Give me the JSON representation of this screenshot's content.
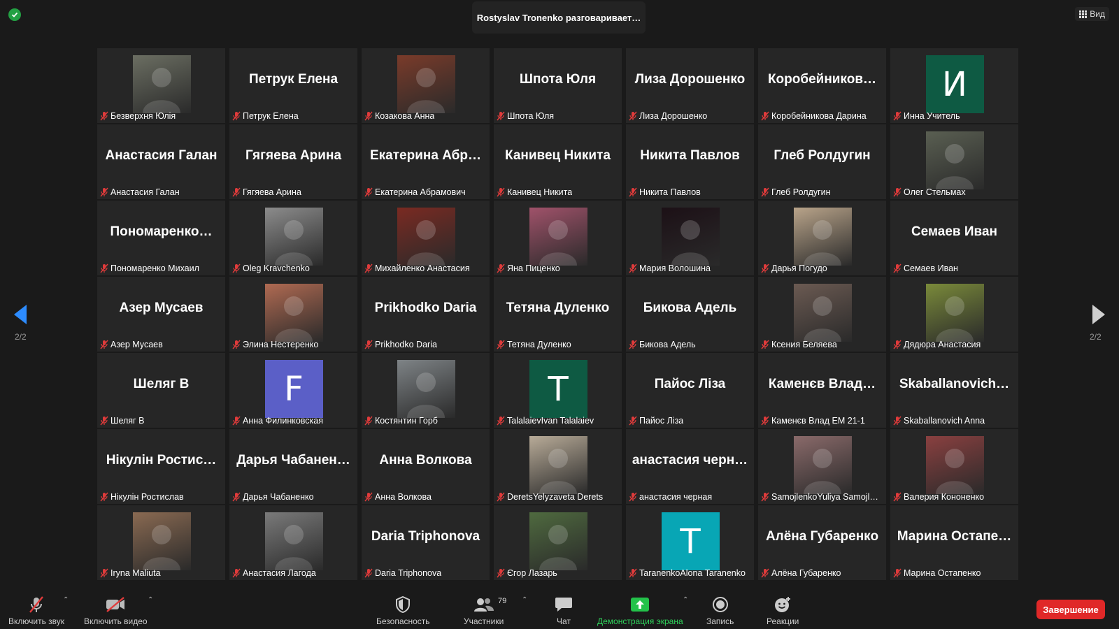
{
  "top": {
    "speaker_banner": "Rostyslav Tronenko разговаривает…",
    "view_label": "Вид"
  },
  "paging": {
    "left_indicator": "2/2",
    "right_indicator": "2/2"
  },
  "participants": [
    {
      "label": "Безверхня Юлія",
      "kind": "photo",
      "bg": "#6b6e62"
    },
    {
      "label": "Петрук Елена",
      "kind": "name",
      "display": "Петрук Елена"
    },
    {
      "label": "Козакова Анна",
      "kind": "photo",
      "bg": "#7a3b2a"
    },
    {
      "label": "Шпота Юля",
      "kind": "name",
      "display": "Шпота Юля"
    },
    {
      "label": "Лиза Дорошенко",
      "kind": "name",
      "display": "Лиза Дорошенко"
    },
    {
      "label": "Коробейникова Дарина",
      "kind": "name",
      "display": "Коробейников…"
    },
    {
      "label": "Инна Учитель",
      "kind": "letter",
      "letter": "И",
      "bg": "#0e5a43"
    },
    {
      "label": "Анастасия Галан",
      "kind": "name",
      "display": "Анастасия Галан"
    },
    {
      "label": "Гягяева Арина",
      "kind": "name",
      "display": "Гягяева Арина"
    },
    {
      "label": "Екатерина Абрамович",
      "kind": "name",
      "display": "Екатерина Абр…"
    },
    {
      "label": "Канивец Никита",
      "kind": "name",
      "display": "Канивец Никита"
    },
    {
      "label": "Никита Павлов",
      "kind": "name",
      "display": "Никита Павлов"
    },
    {
      "label": "Глеб Ролдугин",
      "kind": "name",
      "display": "Глеб Ролдугин"
    },
    {
      "label": "Олег Стельмах",
      "kind": "photo",
      "bg": "#5a5f52"
    },
    {
      "label": "Пономаренко Михаил",
      "kind": "name",
      "display": "Пономаренко…"
    },
    {
      "label": "Oleg Kravchenko",
      "kind": "photo",
      "bg": "#8c8c8c"
    },
    {
      "label": "Михайленко Анастасия",
      "kind": "photo",
      "bg": "#7a2a22"
    },
    {
      "label": "Яна Пиценко",
      "kind": "photo",
      "bg": "#a0526a"
    },
    {
      "label": "Мария Волошина",
      "kind": "photo",
      "bg": "#1c1016"
    },
    {
      "label": "Дарья Погудо",
      "kind": "photo",
      "bg": "#b9a48a"
    },
    {
      "label": "Семаев Иван",
      "kind": "name",
      "display": "Семаев Иван"
    },
    {
      "label": "Азер Мусаев",
      "kind": "name",
      "display": "Азер Мусаев"
    },
    {
      "label": "Элина Нестеренко",
      "kind": "photo",
      "bg": "#b06a52"
    },
    {
      "label": "Prikhodko Daria",
      "kind": "name",
      "display": "Prikhodko Daria"
    },
    {
      "label": "Тетяна Дуленко",
      "kind": "name",
      "display": "Тетяна Дуленко"
    },
    {
      "label": "Бикова Адель",
      "kind": "name",
      "display": "Бикова Адель"
    },
    {
      "label": "Ксения Беляева",
      "kind": "photo",
      "bg": "#6b5a52"
    },
    {
      "label": "Дядюра Анастасия",
      "kind": "photo",
      "bg": "#7a8a3a"
    },
    {
      "label": "Шеляг В",
      "kind": "name",
      "display": "Шеляг В"
    },
    {
      "label": "Анна Филинковская",
      "kind": "letter",
      "letter": "F",
      "bg": "#5b5fc7"
    },
    {
      "label": "Костянтин Горб",
      "kind": "photo",
      "bg": "#7e8386"
    },
    {
      "label": "TalalaievIvan Talalaiev",
      "kind": "letter",
      "letter": "T",
      "bg": "#0e5a43"
    },
    {
      "label": "Пайос Ліза",
      "kind": "name",
      "display": "Пайос Ліза"
    },
    {
      "label": "Каменєв Влад ЕМ 21-1",
      "kind": "name",
      "display": "Каменєв Влад…"
    },
    {
      "label": "Skaballanovich Anna",
      "kind": "name",
      "display": "Skaballanovich…"
    },
    {
      "label": "Нікулін Ростислав",
      "kind": "name",
      "display": "Нікулін Ростис…"
    },
    {
      "label": "Дарья Чабаненко",
      "kind": "name",
      "display": "Дарья Чабанен…"
    },
    {
      "label": "Анна Волкова",
      "kind": "name",
      "display": "Анна Волкова"
    },
    {
      "label": "DeretsYelyzaveta Derets",
      "kind": "photo",
      "bg": "#b8ab98"
    },
    {
      "label": "анастасия черная",
      "kind": "name",
      "display": "анастасия черн…"
    },
    {
      "label": "SamojlenkoYuliya Samojl…",
      "kind": "photo",
      "bg": "#8a6a6a"
    },
    {
      "label": "Валерия Кононенко",
      "kind": "photo",
      "bg": "#8a4040"
    },
    {
      "label": "Iryna Maliuta",
      "kind": "photo",
      "bg": "#8a6a52"
    },
    {
      "label": "Анастасия Лагода",
      "kind": "photo",
      "bg": "#7a7a7a"
    },
    {
      "label": "Daria Triphonova",
      "kind": "name",
      "display": "Daria Triphonova"
    },
    {
      "label": "Єгор Лазарь",
      "kind": "photo",
      "bg": "#4f6a3f"
    },
    {
      "label": "TaranenkoAlona Taranenko",
      "kind": "letter",
      "letter": "T",
      "bg": "#08a6b5"
    },
    {
      "label": "Алёна Губаренко",
      "kind": "name",
      "display": "Алёна Губаренко"
    },
    {
      "label": "Марина Остапенко",
      "kind": "name",
      "display": "Марина Остапе…"
    }
  ],
  "toolbar": {
    "unmute_label": "Включить звук",
    "start_video_label": "Включить видео",
    "security_label": "Безопасность",
    "participants_label": "Участники",
    "participants_count": "79",
    "chat_label": "Чат",
    "share_label": "Демонстрация экрана",
    "record_label": "Запись",
    "reactions_label": "Реакции",
    "end_label": "Завершение"
  },
  "colors": {
    "background": "#1a1a1a",
    "tile": "#262626",
    "muted_icon": "#e03b3b",
    "share_green": "#23c24a",
    "end_red": "#e02828",
    "nav_blue": "#2d8cff"
  }
}
